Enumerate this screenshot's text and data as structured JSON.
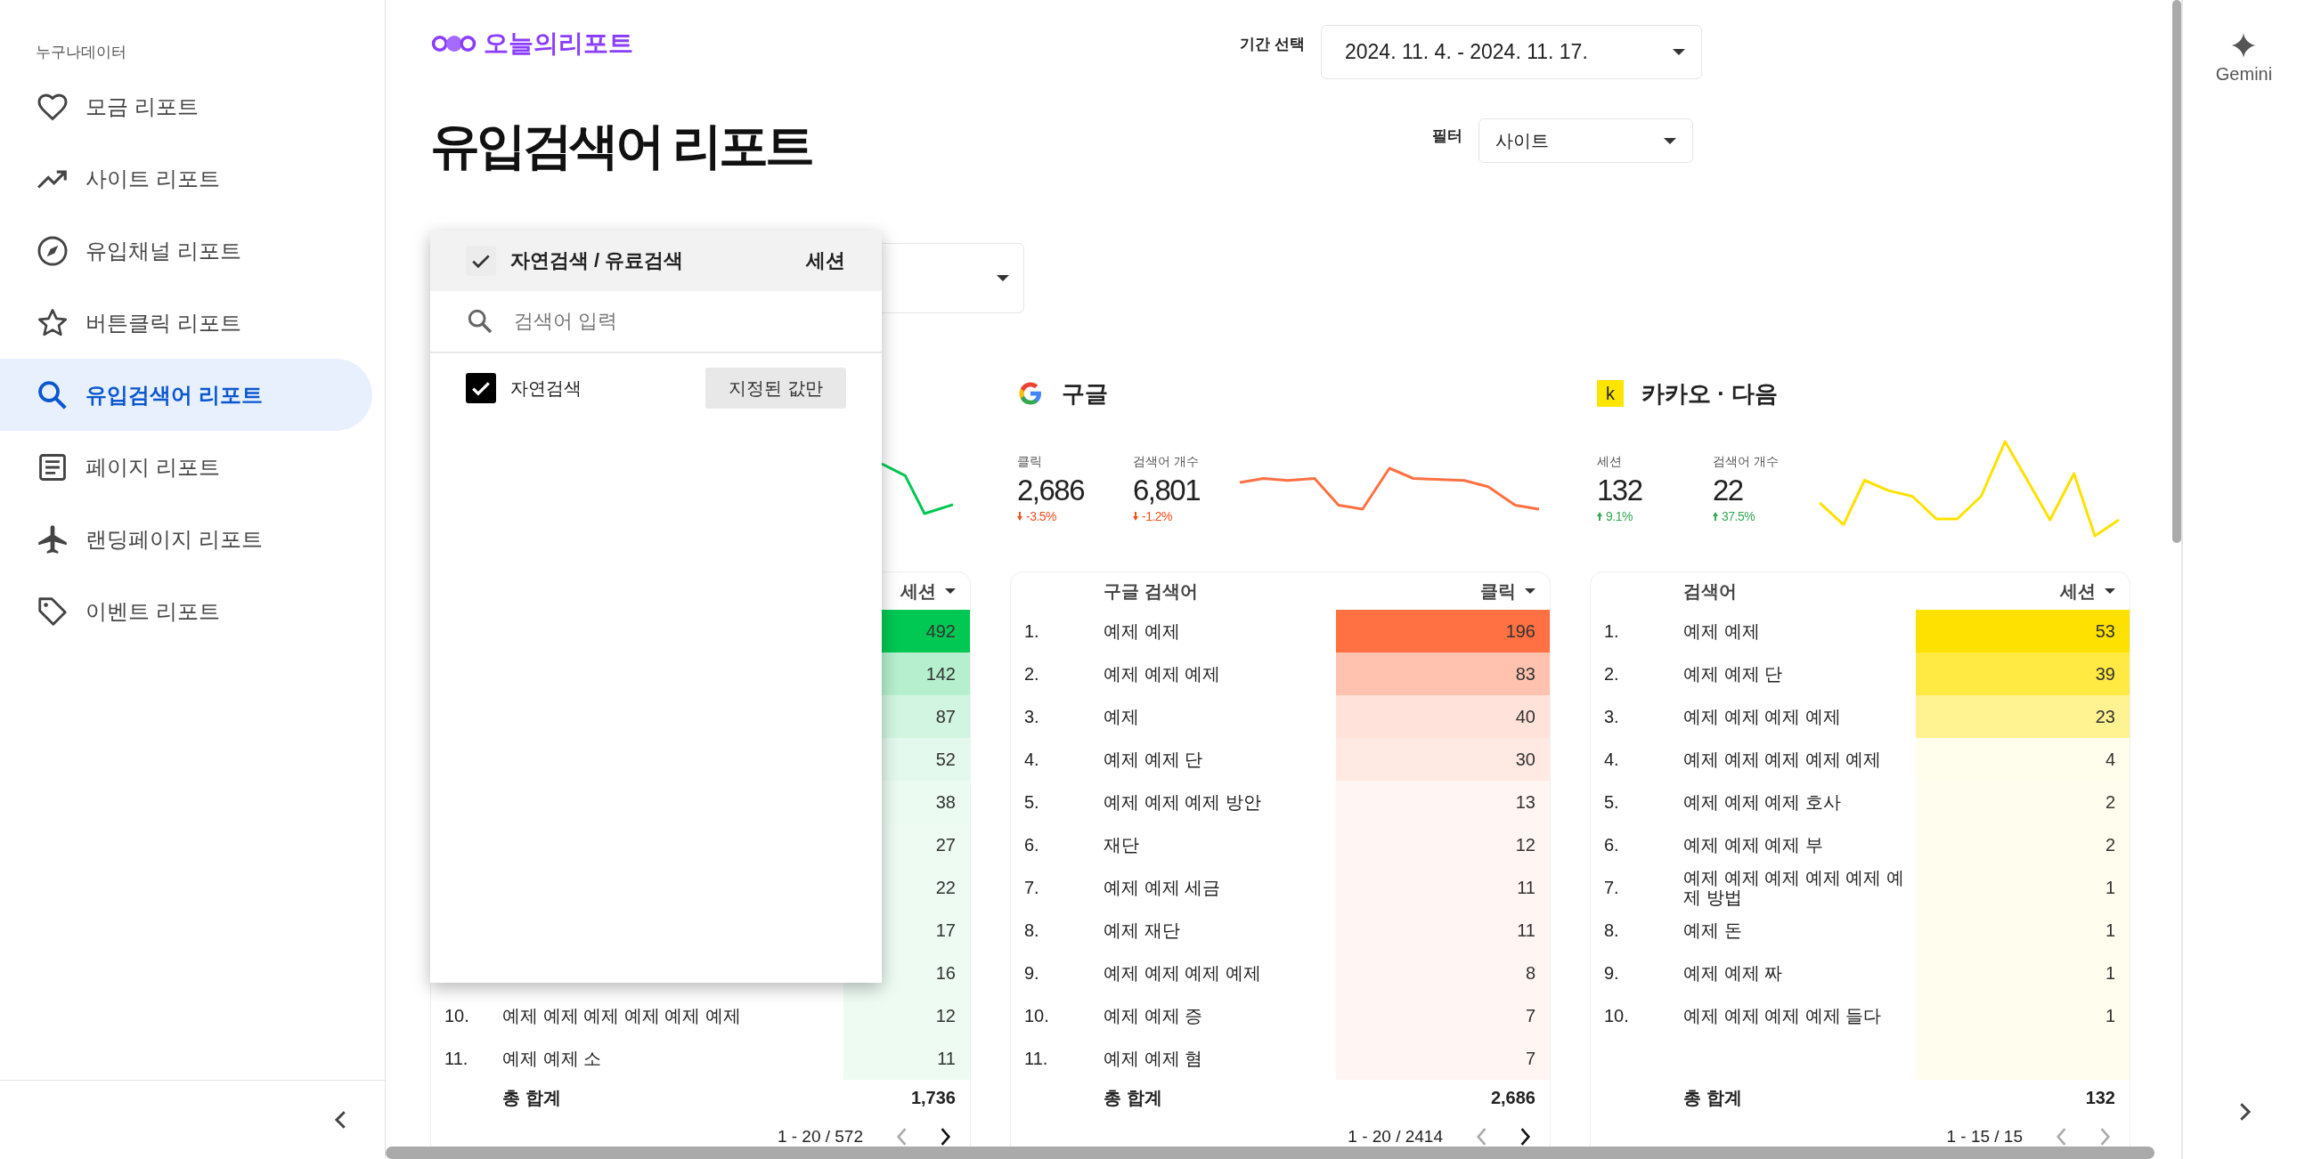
{
  "sidebar": {
    "brand": "누구나데이터",
    "items": [
      {
        "label": "모금 리포트",
        "selected": false
      },
      {
        "label": "사이트 리포트",
        "selected": false
      },
      {
        "label": "유입채널 리포트",
        "selected": false
      },
      {
        "label": "버튼클릭 리포트",
        "selected": false
      },
      {
        "label": "유입검색어 리포트",
        "selected": true
      },
      {
        "label": "페이지 리포트",
        "selected": false
      },
      {
        "label": "랜딩페이지 리포트",
        "selected": false
      },
      {
        "label": "이벤트 리포트",
        "selected": false
      }
    ]
  },
  "logo": {
    "text": "오늘의리포트"
  },
  "title": "유입검색어 리포트",
  "date_filter": {
    "label": "기간 선택",
    "value": "2024. 11. 4. - 2024. 11. 17."
  },
  "site_filter": {
    "label": "필터",
    "value": "사이트"
  },
  "sources": [
    {
      "color": "#00c853",
      "table": {
        "value_column": "세션",
        "rows": [
          {
            "value": "492"
          },
          {
            "value": "142"
          },
          {
            "value": "87"
          },
          {
            "value": "52"
          },
          {
            "value": "38"
          },
          {
            "value": "27"
          },
          {
            "value": "22"
          },
          {
            "value": "17"
          },
          {
            "value": "16"
          },
          {
            "rank": "10.",
            "keyword": "예제 예제 예제 예제 예제 예제",
            "value": "12"
          },
          {
            "rank": "11.",
            "keyword": "예제 예제 소",
            "value": "11"
          }
        ],
        "total_label": "총 합계",
        "total": "1,736",
        "pagination": "1 - 20 / 572",
        "prev_disabled": true,
        "next_disabled": false
      }
    },
    {
      "kind": "gmark",
      "title": "구글",
      "color": "#ff7043",
      "metrics": [
        {
          "label": "클릭",
          "value": "2,686",
          "delta": {
            "text": "-3.5%",
            "up": false
          }
        },
        {
          "label": "검색어 개수",
          "value": "6,801",
          "delta": {
            "text": "-1.2%",
            "up": false
          }
        }
      ],
      "table": {
        "key_column": "구글 검색어",
        "value_column": "클릭",
        "rows": [
          {
            "rank": "1.",
            "keyword": "예제 예제",
            "value": "196"
          },
          {
            "rank": "2.",
            "keyword": "예제 예제 예제",
            "value": "83"
          },
          {
            "rank": "3.",
            "keyword": "예제",
            "value": "40"
          },
          {
            "rank": "4.",
            "keyword": "예제 예제 단",
            "value": "30"
          },
          {
            "rank": "5.",
            "keyword": "예제 예제 예제 방안",
            "value": "13"
          },
          {
            "rank": "6.",
            "keyword": "재단",
            "value": "12"
          },
          {
            "rank": "7.",
            "keyword": "예제 예제 세금",
            "value": "11"
          },
          {
            "rank": "8.",
            "keyword": "예제 재단",
            "value": "11"
          },
          {
            "rank": "9.",
            "keyword": "예제 예제 예제 예제",
            "value": "8"
          },
          {
            "rank": "10.",
            "keyword": "예제 예제 증",
            "value": "7"
          },
          {
            "rank": "11.",
            "keyword": "예제 예제 혐",
            "value": "7"
          }
        ],
        "total_label": "총 합계",
        "total": "2,686",
        "pagination": "1 - 20 / 2414",
        "prev_disabled": true,
        "next_disabled": false
      }
    },
    {
      "kind": "letter",
      "logo_text": "k",
      "title": "카카오 · 다음",
      "color": "#ffe100",
      "metrics": [
        {
          "label": "세션",
          "value": "132",
          "delta": {
            "text": "9.1%",
            "up": true
          }
        },
        {
          "label": "검색어 개수",
          "value": "22",
          "delta": {
            "text": "37.5%",
            "up": true
          }
        }
      ],
      "table": {
        "key_column": "검색어",
        "value_column": "세션",
        "rows": [
          {
            "rank": "1.",
            "keyword": "예제 예제",
            "value": "53"
          },
          {
            "rank": "2.",
            "keyword": "예제 예제 단",
            "value": "39"
          },
          {
            "rank": "3.",
            "keyword": "예제 예제 예제 예제",
            "value": "23"
          },
          {
            "rank": "4.",
            "keyword": "예제 예제 예제 예제 예제",
            "value": "4"
          },
          {
            "rank": "5.",
            "keyword": "예제 예제 예제 호사",
            "value": "2"
          },
          {
            "rank": "6.",
            "keyword": "예제 예제 예제 부",
            "value": "2"
          },
          {
            "rank": "7.",
            "keyword": "예제 예제 예제 예제 예제 예제 방법",
            "value": "1"
          },
          {
            "rank": "8.",
            "keyword": "예제 돈",
            "value": "1"
          },
          {
            "rank": "9.",
            "keyword": "예제 예제 짜",
            "value": "1"
          },
          {
            "rank": "10.",
            "keyword": "예제 예제 예제 예제 들다",
            "value": "1"
          }
        ],
        "total_label": "총 합계",
        "total": "132",
        "pagination": "1 - 15 / 15",
        "prev_disabled": true,
        "next_disabled": true
      }
    }
  ],
  "dropdown_popup": {
    "header": {
      "label": "자연검색 / 유료검색",
      "metric": "세션",
      "checked": true
    },
    "search_placeholder": "검색어 입력",
    "options": [
      {
        "label": "자연검색",
        "checked": true,
        "only_button": "지정된 값만"
      }
    ]
  },
  "assistant_panel": {
    "label": "Gemini"
  }
}
